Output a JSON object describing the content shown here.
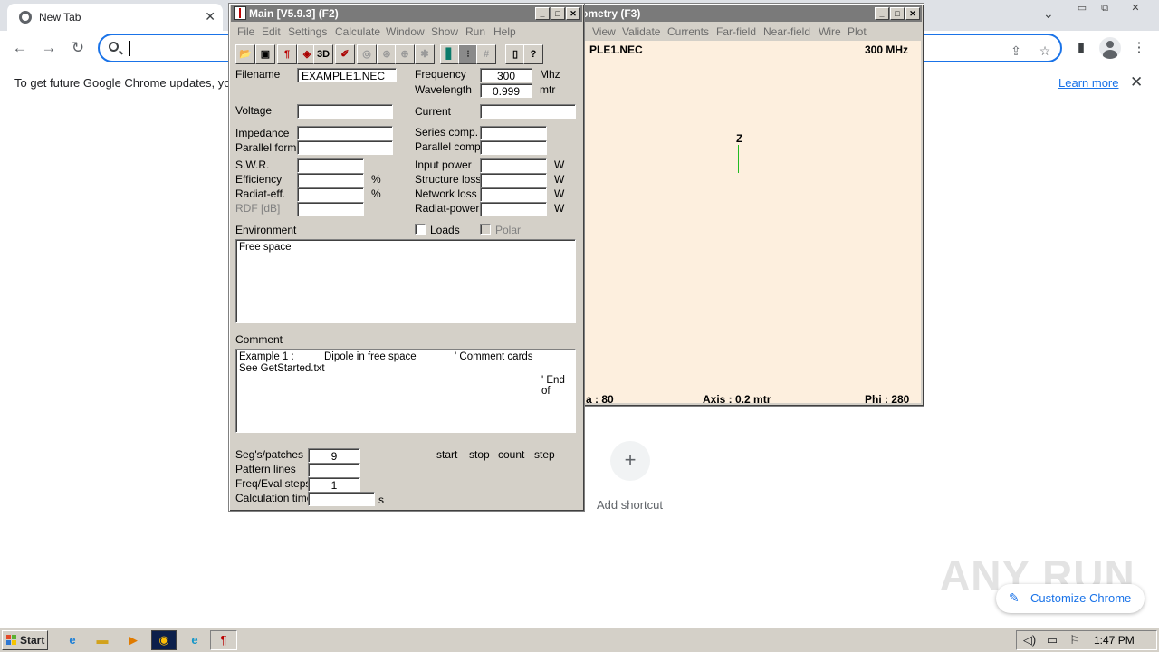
{
  "chrome": {
    "tab_title": "New Tab",
    "omnibox_value": "",
    "infobar_text": "To get future Google Chrome updates, you",
    "infobar_link": "Learn more",
    "add_shortcut_label": "Add shortcut",
    "customize_label": "Customize Chrome",
    "watermark": "ANY RUN"
  },
  "main_window": {
    "title": "Main [V5.9.3]  (F2)",
    "menu": [
      "File",
      "Edit",
      "Settings",
      "Calculate",
      "Window",
      "Show",
      "Run",
      "Help"
    ],
    "toolbar_icons": [
      "open-icon",
      "save-icon",
      "antenna-icon",
      "cube-icon",
      "3d-icon",
      "edit-icon",
      "pattern-icon",
      "sphere-icon",
      "globe-icon",
      "config-icon",
      "book-icon",
      "grid-icon",
      "hash-icon",
      "manual-icon",
      "help-icon"
    ],
    "labels": {
      "filename": "Filename",
      "frequency": "Frequency",
      "freq_unit": "Mhz",
      "wavelength": "Wavelength",
      "wavelength_unit": "mtr",
      "voltage": "Voltage",
      "current": "Current",
      "impedance": "Impedance",
      "series_comp": "Series comp.",
      "parallel_form": "Parallel form",
      "parallel_comp": "Parallel comp.",
      "swr": "S.W.R.",
      "input_power": "Input power",
      "efficiency": "Efficiency",
      "structure_loss": "Structure loss",
      "radiat_eff": "Radiat-eff.",
      "network_loss": "Network loss",
      "rdf": "RDF [dB]",
      "radiat_power": "Radiat-power",
      "percent": "%",
      "watt": "W",
      "environment": "Environment",
      "loads": "Loads",
      "polar": "Polar",
      "comment": "Comment",
      "segs": "Seg's/patches",
      "pattern_lines": "Pattern lines",
      "freq_eval_steps": "Freq/Eval steps",
      "calc_time": "Calculation time",
      "seconds": "s",
      "start": "start",
      "stop": "stop",
      "count": "count",
      "step": "step"
    },
    "values": {
      "filename": "EXAMPLE1.NEC",
      "frequency": "300",
      "wavelength": "0.999",
      "segs": "9",
      "freq_eval_steps": "1",
      "environment_text": "Free space",
      "comment_line1_a": "Example 1 :",
      "comment_line1_b": "Dipole in free space",
      "comment_line1_c": "' Comment cards",
      "comment_line2": "See GetStarted.txt",
      "comment_line3": "' End of"
    }
  },
  "geometry_window": {
    "title": "ometry  (F3)",
    "menu": [
      "View",
      "Validate",
      "Currents",
      "Far-field",
      "Near-field",
      "Wire",
      "Plot"
    ],
    "file_label": "PLE1.NEC",
    "freq_label": "300 MHz",
    "axis_z": "Z",
    "theta_label": "a : 80",
    "axis_label": "Axis : 0.2 mtr",
    "phi_label": "Phi : 280"
  },
  "taskbar": {
    "start_label": "Start",
    "clock": "1:47 PM",
    "quick_launch": [
      "ie-icon",
      "folder-icon",
      "media-icon",
      "chrome-icon",
      "edge-icon",
      "4nec2-icon"
    ],
    "tray": [
      "volume-icon",
      "network-icon",
      "flag-icon"
    ]
  }
}
